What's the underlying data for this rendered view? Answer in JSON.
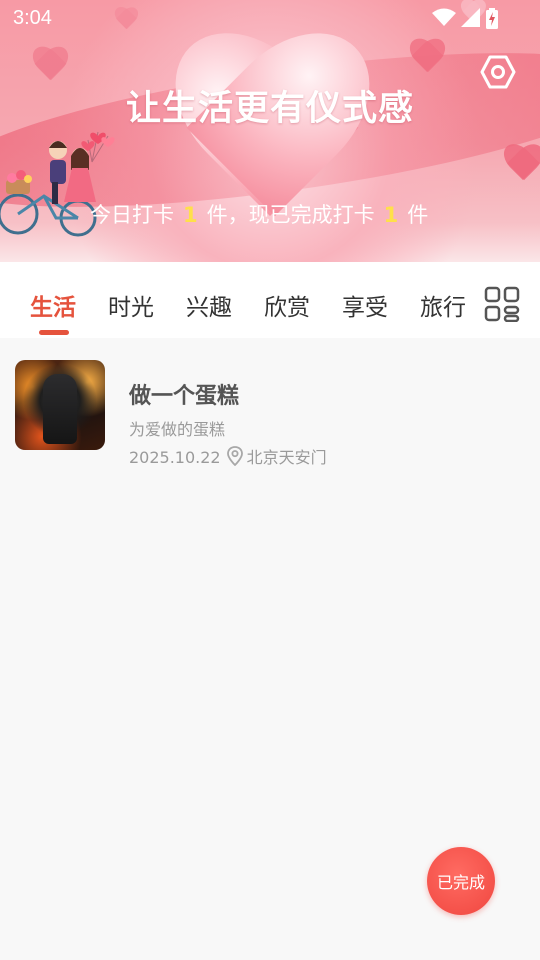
{
  "status_bar": {
    "time": "3:04"
  },
  "banner": {
    "title": "让生活更有仪式感",
    "checkin_prefix": "今日打卡",
    "today_count": "1",
    "checkin_middle": "件，现已完成打卡",
    "total_count": "1",
    "checkin_suffix": "件"
  },
  "tabs": [
    {
      "label": "生活",
      "active": true
    },
    {
      "label": "时光",
      "active": false
    },
    {
      "label": "兴趣",
      "active": false
    },
    {
      "label": "欣赏",
      "active": false
    },
    {
      "label": "享受",
      "active": false
    },
    {
      "label": "旅行",
      "active": false
    }
  ],
  "items": [
    {
      "title": "做一个蛋糕",
      "description": "为爱做的蛋糕",
      "date": "2025.10.22",
      "location": "北京天安门"
    }
  ],
  "done_button": {
    "label": "已完成"
  },
  "colors": {
    "accent": "#e5533d",
    "highlight": "#ffe04a",
    "done_button": "#f0463f",
    "banner_pink": "#f79aa5"
  },
  "icons": {
    "settings": "hexagon-settings-icon",
    "grid": "grid-view-icon",
    "location": "location-pin-icon",
    "wifi": "wifi-icon",
    "signal": "signal-icon",
    "battery": "battery-charging-icon"
  }
}
